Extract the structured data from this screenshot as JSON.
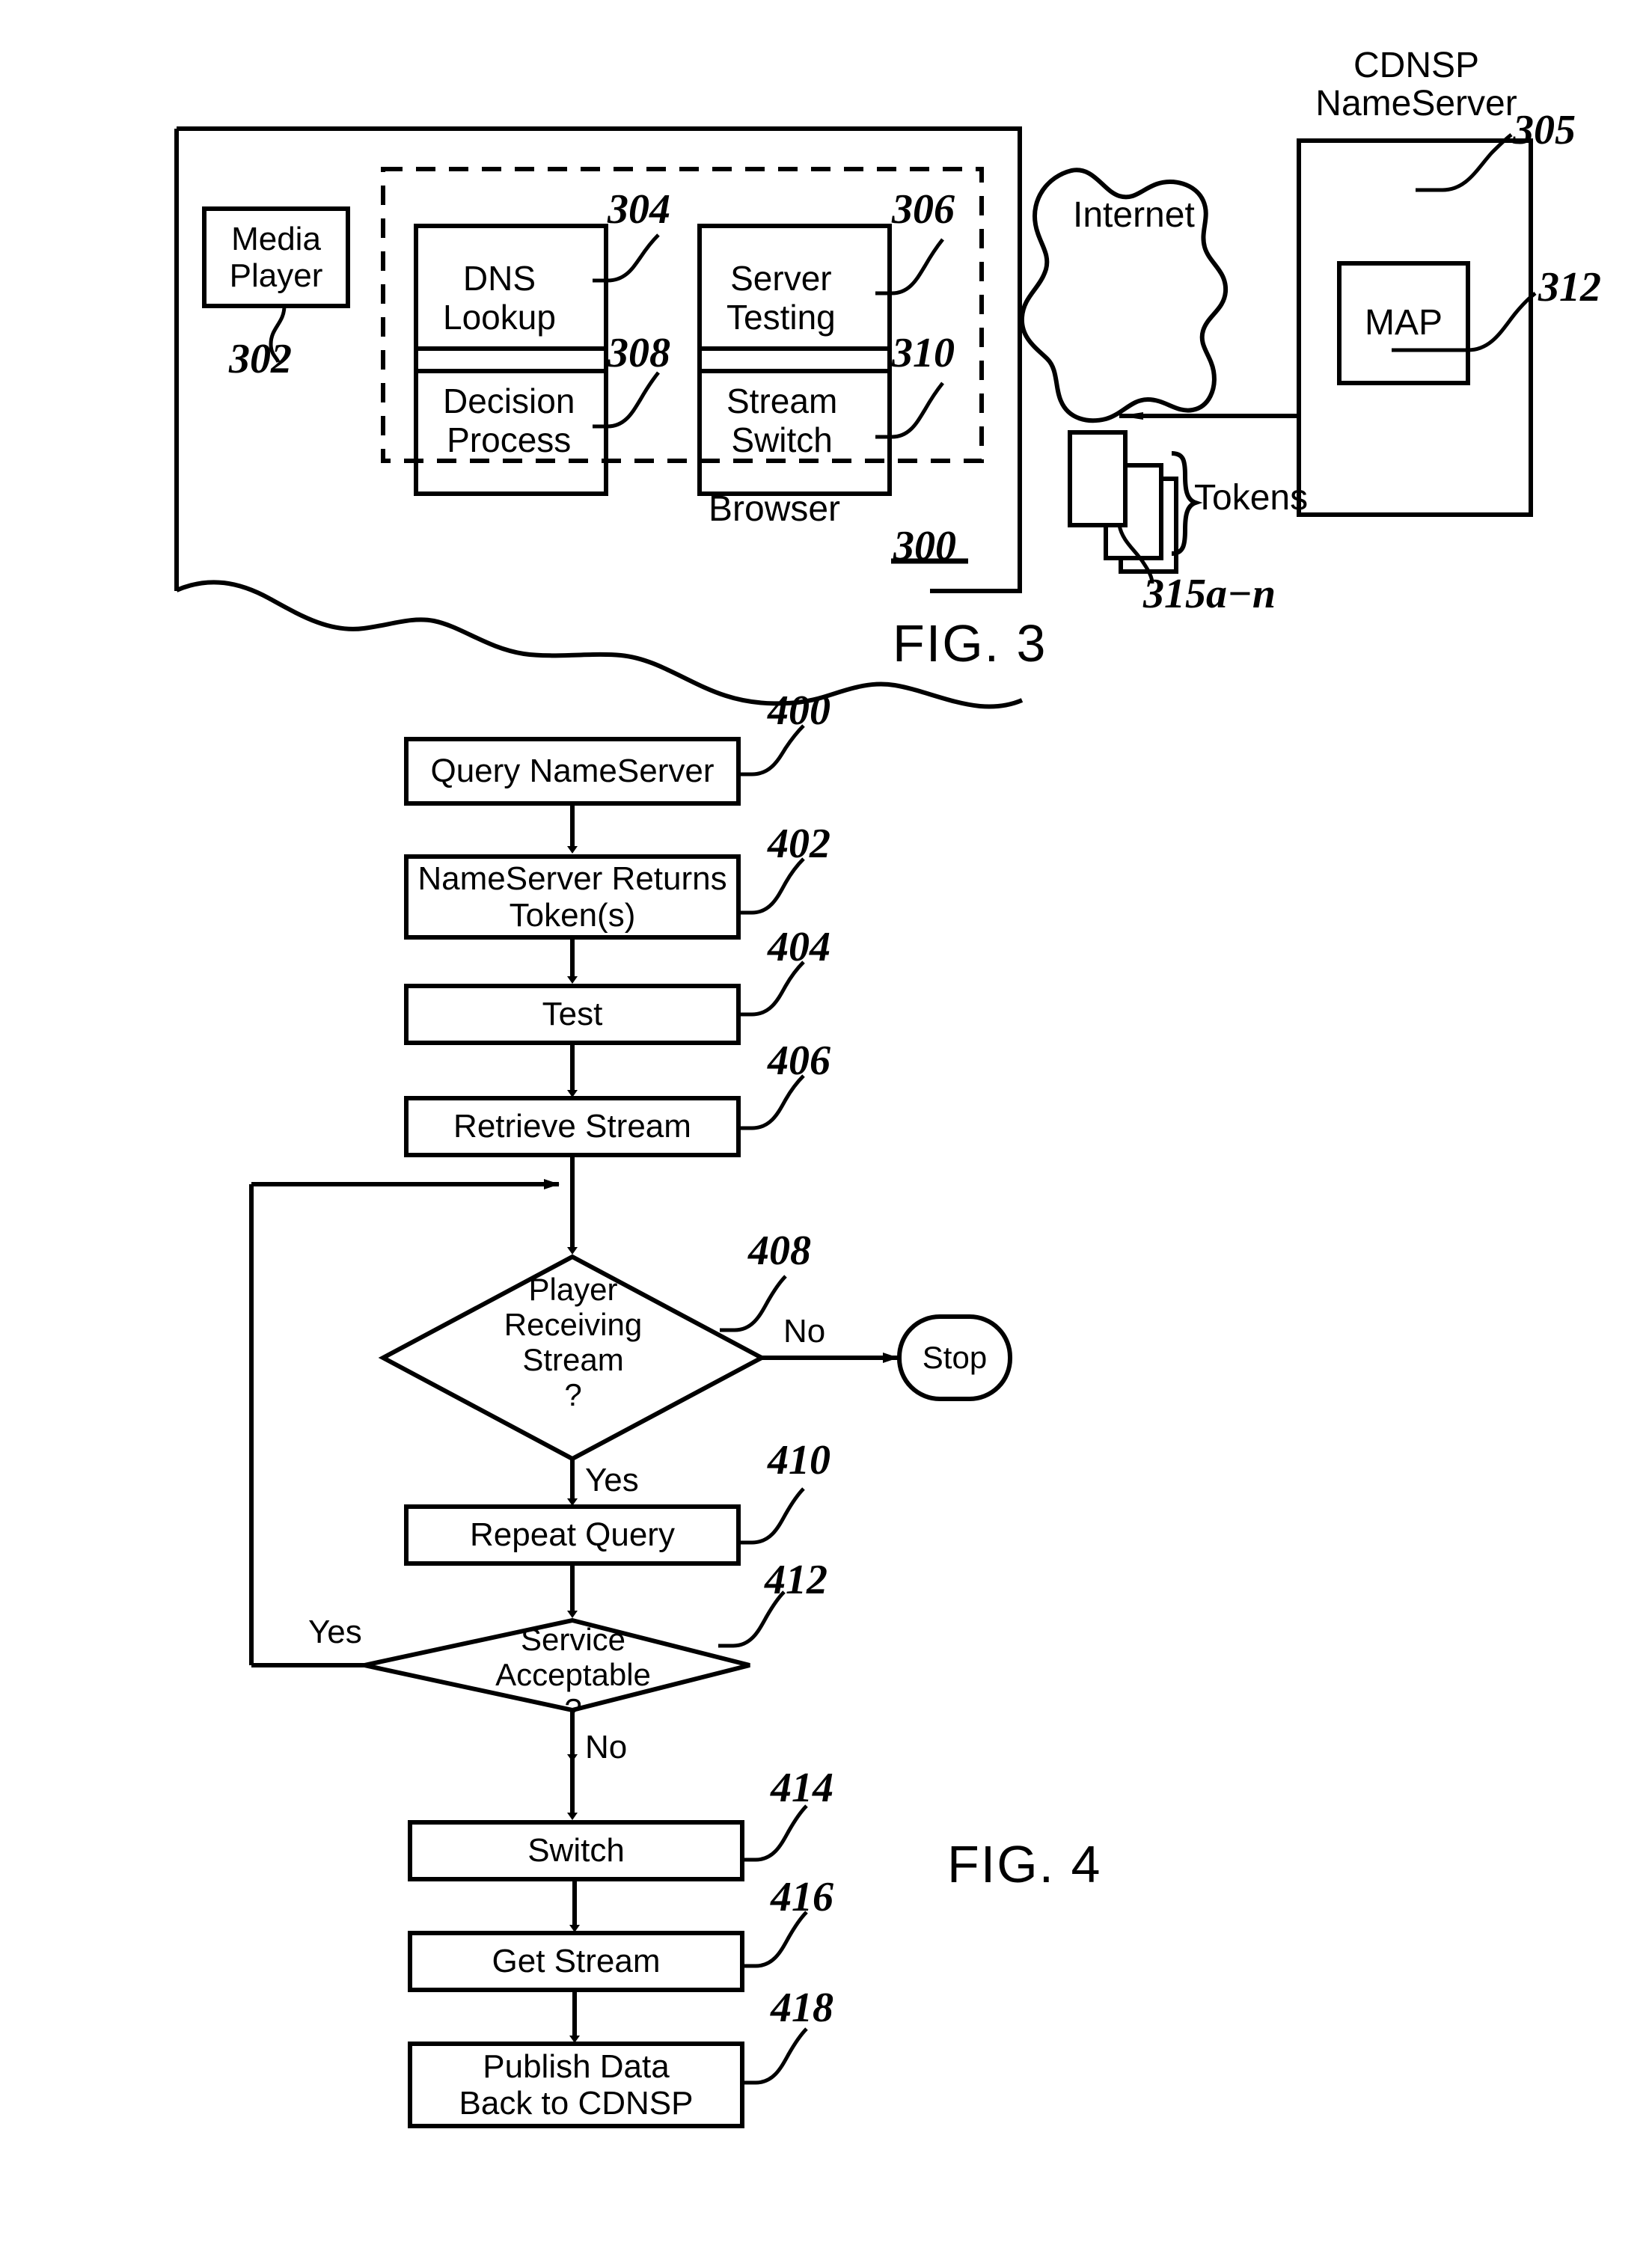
{
  "figure3": {
    "label": "FIG. 3",
    "browser_container": {
      "caption": "Browser",
      "ref": "300"
    },
    "media_player": {
      "label": "Media\nPlayer",
      "ref": "302"
    },
    "dashed_group_blocks": [
      {
        "label": "DNS\nLookup",
        "ref": "304"
      },
      {
        "label": "Server\nTesting",
        "ref": "306"
      },
      {
        "label": "Decision\nProcess",
        "ref": "308"
      },
      {
        "label": "Stream\nSwitch",
        "ref": "310"
      }
    ],
    "cloud": {
      "label": "Internet"
    },
    "nameserver": {
      "title": "CDNSP\nNameServer",
      "title_line1": "CDNSP",
      "title_line2": "NameServer",
      "ref": "305",
      "inner_block": {
        "label": "MAP",
        "ref": "312"
      }
    },
    "tokens": {
      "label": "Tokens",
      "ref": "315a−n",
      "count": 3
    }
  },
  "figure4": {
    "label": "FIG. 4",
    "nodes": [
      {
        "id": "400",
        "type": "process",
        "label": "Query NameServer"
      },
      {
        "id": "402",
        "type": "process",
        "label": "NameServer Returns\nToken(s)"
      },
      {
        "id": "404",
        "type": "process",
        "label": "Test"
      },
      {
        "id": "406",
        "type": "process",
        "label": "Retrieve Stream"
      },
      {
        "id": "408",
        "type": "decision",
        "label": "Player\nReceiving\nStream\n?"
      },
      {
        "id": "410",
        "type": "process",
        "label": "Repeat Query"
      },
      {
        "id": "412",
        "type": "decision",
        "label": "Service\nAcceptable\n?"
      },
      {
        "id": "414",
        "type": "process",
        "label": "Switch"
      },
      {
        "id": "416",
        "type": "process",
        "label": "Get Stream"
      },
      {
        "id": "418",
        "type": "process",
        "label": "Publish Data\nBack to CDNSP"
      },
      {
        "id": "stop",
        "type": "terminator",
        "label": "Stop"
      }
    ],
    "edge_labels": {
      "d408_no": "No",
      "d408_yes": "Yes",
      "d412_yes": "Yes",
      "d412_no": "No"
    }
  },
  "colors": {
    "ink": "#000000",
    "paper": "#ffffff"
  }
}
